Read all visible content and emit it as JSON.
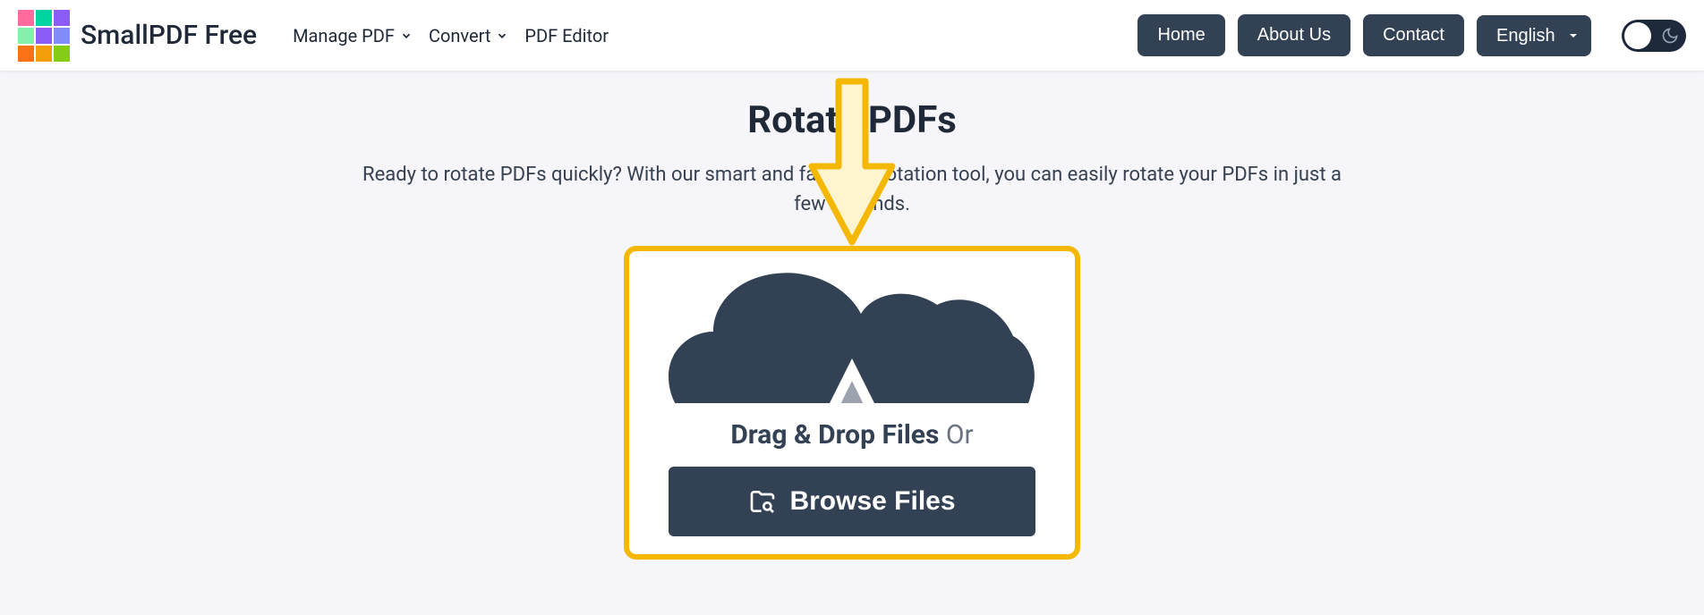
{
  "header": {
    "logo_text": "SmallPDF Free",
    "nav": {
      "manage_pdf": "Manage PDF",
      "convert": "Convert",
      "pdf_editor": "PDF Editor"
    },
    "buttons": {
      "home": "Home",
      "about": "About Us",
      "contact": "Contact"
    },
    "language": "English"
  },
  "main": {
    "title": "Rotate PDFs",
    "subtitle": "Ready to rotate PDFs quickly? With our smart and fast PDF rotation tool, you can easily rotate your PDFs in just a few seconds.",
    "drag_drop_label": "Drag & Drop Files",
    "or_label": "Or",
    "browse_label": "Browse Files"
  },
  "colors": {
    "accent": "#f5b800",
    "dark": "#334155"
  }
}
